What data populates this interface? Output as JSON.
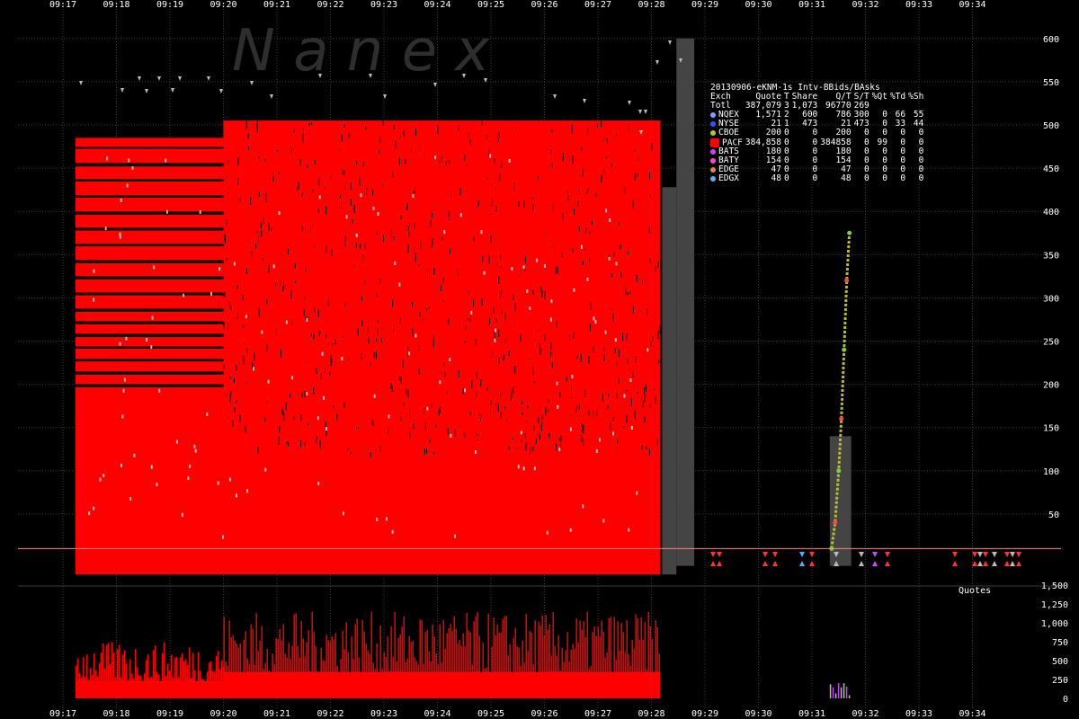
{
  "watermark": "N a n e x",
  "colors": {
    "background": "#000000",
    "grid": "#3a3a3a",
    "quotes": "#ff0000",
    "gray_bar": "#444444",
    "trade_marker": "#bbbbbb",
    "baseline": "#ff8080"
  },
  "stats": {
    "title": "20130906-eKNM-1s Intv-BBids/BAsks",
    "headers": [
      "Exch",
      "Quote",
      "T",
      "Share",
      "Q/T",
      "S/T",
      "%Qt",
      "%Td",
      "%Sh"
    ],
    "total": [
      "Totl",
      "387,079",
      "3",
      "1,073",
      "96770",
      "269",
      "",
      "",
      ""
    ],
    "rows": [
      {
        "exch": "NQEX",
        "color": "#8899ff",
        "icon": "circle-icon",
        "vals": [
          "1,571",
          "2",
          "600",
          "786",
          "300",
          "0",
          "66",
          "55"
        ]
      },
      {
        "exch": "NYSE",
        "color": "#3355ff",
        "icon": "circle-icon",
        "vals": [
          "21",
          "1",
          "473",
          "21",
          "473",
          "0",
          "33",
          "44"
        ]
      },
      {
        "exch": "CBOE",
        "color": "#aacc33",
        "icon": "circle-icon",
        "vals": [
          "200",
          "0",
          "0",
          "200",
          "0",
          "0",
          "0",
          "0"
        ]
      },
      {
        "exch": "PACF",
        "color": "#ff0000",
        "icon": "square-icon",
        "vals": [
          "384,858",
          "0",
          "0",
          "384858",
          "0",
          "99",
          "0",
          "0"
        ]
      },
      {
        "exch": "BATS",
        "color": "#cc44ff",
        "icon": "diamond-icon",
        "vals": [
          "180",
          "0",
          "0",
          "180",
          "0",
          "0",
          "0",
          "0"
        ]
      },
      {
        "exch": "BATY",
        "color": "#ff44cc",
        "icon": "diamond-icon",
        "vals": [
          "154",
          "0",
          "0",
          "154",
          "0",
          "0",
          "0",
          "0"
        ]
      },
      {
        "exch": "EDGE",
        "color": "#dd8833",
        "icon": "diamond-icon",
        "vals": [
          "47",
          "0",
          "0",
          "47",
          "0",
          "0",
          "0",
          "0"
        ]
      },
      {
        "exch": "EDGX",
        "color": "#66aaee",
        "icon": "diamond-icon",
        "vals": [
          "48",
          "0",
          "0",
          "48",
          "0",
          "0",
          "0",
          "0"
        ]
      }
    ]
  },
  "chart_data": {
    "type": "bar",
    "x_ticks": [
      "09:17",
      "09:18",
      "09:19",
      "09:20",
      "09:21",
      "09:22",
      "09:23",
      "09:24",
      "09:25",
      "09:26",
      "09:27",
      "09:28",
      "09:29",
      "09:30",
      "09:31",
      "09:32",
      "09:33",
      "09:34"
    ],
    "price_panel": {
      "ylim": [
        0,
        600
      ],
      "y_ticks": [
        50,
        100,
        150,
        200,
        250,
        300,
        350,
        400,
        450,
        500,
        550,
        600
      ],
      "baseline_price": 10,
      "quote_band": {
        "segment1": {
          "start": "09:17:14",
          "end": "09:20:00",
          "low": -20,
          "high": 485
        },
        "segment2": {
          "start": "09:20:00",
          "end": "09:28:10",
          "low": -20,
          "high": 505
        }
      },
      "gray_bars": [
        {
          "start": "09:28:12",
          "end": "09:28:28",
          "low": -20,
          "high": 428
        },
        {
          "start": "09:28:28",
          "end": "09:28:48",
          "low": -10,
          "high": 600
        },
        {
          "start": "09:31:20",
          "end": "09:31:44",
          "low": -10,
          "high": 140
        }
      ],
      "spike": [
        {
          "t": "09:31:22",
          "price": 10
        },
        {
          "t": "09:31:26",
          "price": 40
        },
        {
          "t": "09:31:30",
          "price": 100
        },
        {
          "t": "09:31:33",
          "price": 160
        },
        {
          "t": "09:31:36",
          "price": 240
        },
        {
          "t": "09:31:39",
          "price": 320
        },
        {
          "t": "09:31:42",
          "price": 375
        }
      ]
    },
    "quotes_panel": {
      "label": "Quotes",
      "ylim": [
        0,
        1500
      ],
      "y_ticks": [
        0,
        250,
        500,
        750,
        1000,
        1250,
        1500
      ],
      "segments": [
        {
          "start": "09:17:14",
          "end": "09:20:00",
          "avg": 650
        },
        {
          "start": "09:20:00",
          "end": "09:28:10",
          "avg": 1000
        }
      ]
    }
  }
}
